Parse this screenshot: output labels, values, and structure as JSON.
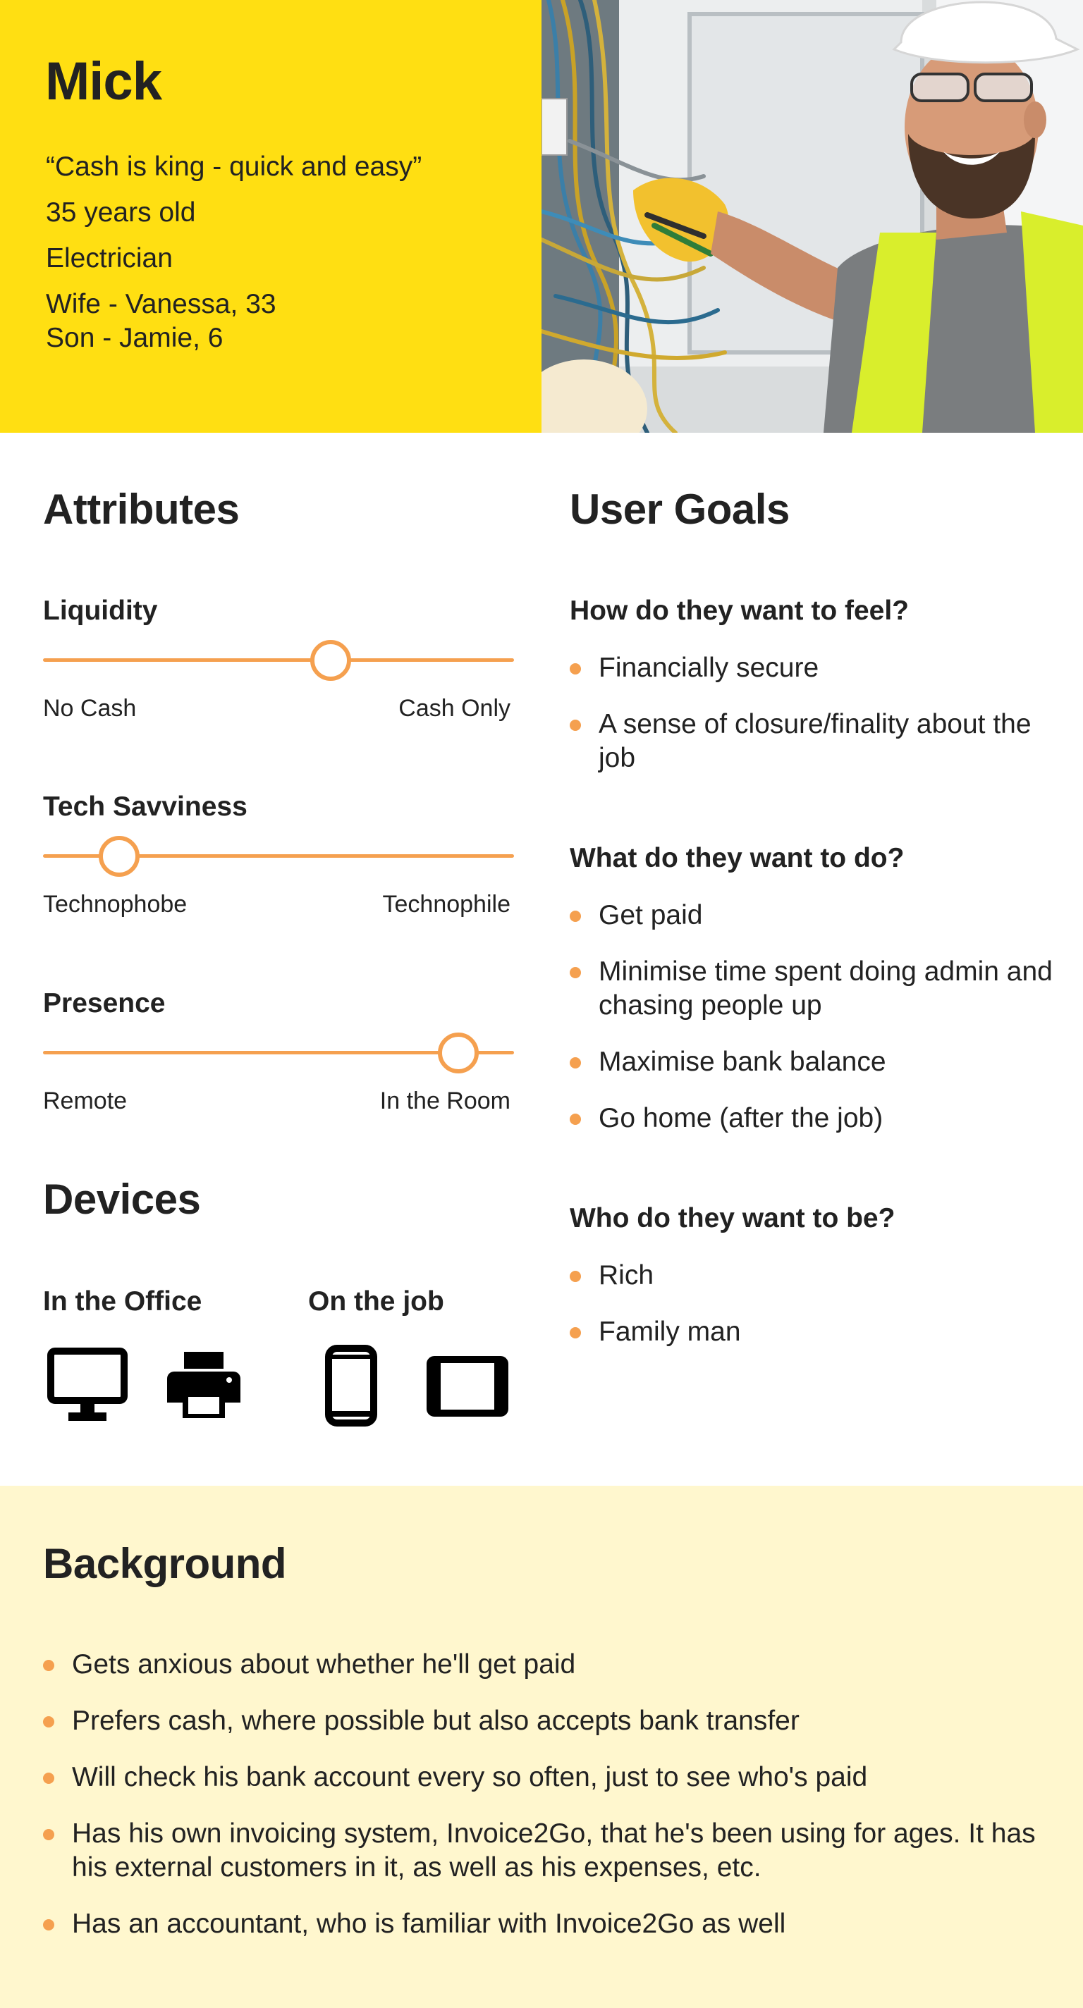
{
  "persona": {
    "name": "Mick",
    "quote": "“Cash is king - quick and easy”",
    "age": "35 years old",
    "occupation": "Electrician",
    "family": [
      "Wife - Vanessa, 33",
      "Son - Jamie, 6"
    ],
    "photo_alt": "Smiling electrician in a white hard hat, safety glasses and yellow high-visibility vest working at an electrical panel"
  },
  "attributes": {
    "title": "Attributes",
    "sliders": [
      {
        "name": "Liquidity",
        "min_label": "No Cash",
        "max_label": "Cash Only",
        "value": 0.61
      },
      {
        "name": "Tech Savviness",
        "min_label": "Technophobe",
        "max_label": "Technophile",
        "value": 0.16
      },
      {
        "name": "Presence",
        "min_label": "Remote",
        "max_label": "In the Room",
        "value": 0.88
      }
    ]
  },
  "devices": {
    "title": "Devices",
    "groups": [
      {
        "label": "In the Office",
        "icons": [
          "desktop-monitor-icon",
          "printer-icon"
        ]
      },
      {
        "label": "On the job",
        "icons": [
          "smartphone-icon",
          "tablet-icon"
        ]
      }
    ]
  },
  "user_goals": {
    "title": "User Goals",
    "groups": [
      {
        "question": "How do they want to feel?",
        "items": [
          "Financially secure",
          "A sense of closure/finality about the job"
        ]
      },
      {
        "question": "What do they want to do?",
        "items": [
          "Get paid",
          "Minimise time spent doing admin and chasing people up",
          "Maximise bank balance",
          "Go home (after the job)"
        ]
      },
      {
        "question": "Who do they want to be?",
        "items": [
          "Rich",
          "Family man"
        ]
      }
    ]
  },
  "background": {
    "title": "Background",
    "items": [
      "Gets anxious about whether he'll get paid",
      "Prefers cash, where possible but also accepts bank transfer",
      "Will check his bank account every so often, just to see who's paid",
      "Has his own invoicing system, Invoice2Go, that he's been using for ages. It has his external customers in it, as well as his expenses, etc.",
      "Has an accountant, who is familiar with Invoice2Go as well"
    ]
  },
  "colors": {
    "hero_yellow": "#FFDF12",
    "accent_orange": "#F5A04F",
    "background_panel": "#FFF7CE",
    "text": "#222222"
  }
}
